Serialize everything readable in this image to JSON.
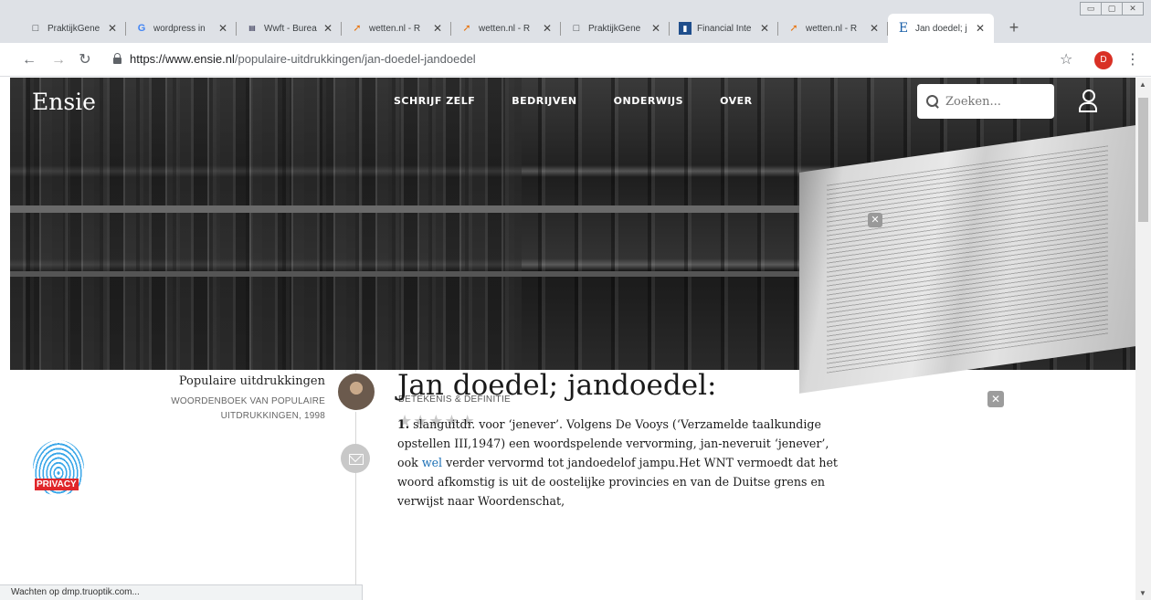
{
  "browser": {
    "tabs": [
      {
        "title": "PraktijkGene",
        "icon": "document-icon"
      },
      {
        "title": "wordpress in",
        "icon": "google-icon"
      },
      {
        "title": "Wwft - Burea",
        "icon": "site-icon"
      },
      {
        "title": "wetten.nl - R",
        "icon": "wetten-icon"
      },
      {
        "title": "wetten.nl - R",
        "icon": "wetten-icon"
      },
      {
        "title": "PraktijkGene",
        "icon": "document-icon"
      },
      {
        "title": "Financial Inte",
        "icon": "bank-icon"
      },
      {
        "title": "wetten.nl - R",
        "icon": "wetten-icon"
      },
      {
        "title": "Jan doedel; j",
        "icon": "ensie-icon",
        "active": true
      }
    ],
    "url_host": "https://www.ensie.nl",
    "url_path": "/populaire-uitdrukkingen/jan-doedel-jandoedel",
    "profile_initial": "D",
    "status_text": "Wachten op dmp.truoptik.com..."
  },
  "site": {
    "logo": "Ensie",
    "nav": [
      "SCHRIJF ZELF",
      "BEDRIJVEN",
      "ONDERWIJS",
      "OVER"
    ],
    "search_placeholder": "Zoeken...",
    "privacy_label": "PRIVACY"
  },
  "sidebar": {
    "dictionary_name": "Populaire uitdrukkingen",
    "dictionary_sub": "WOORDENBOEK VAN POPULAIRE UITDRUKKINGEN, 1998"
  },
  "article": {
    "kicker": "BETEKENIS & DEFINITIE",
    "rating": 0,
    "rating_max": 5,
    "title": "Jan doedel; jandoedel:",
    "body_number": "1.",
    "body_part1": " slanguitdr. voor ‘jenever’. Volgens De Vooys (‘Verzamelde taalkundige opstellen III,1947) een woordspelende vervorming, jan-neveruit ‘jenever’, ook ",
    "body_link": "wel",
    "body_part2": " verder vervormd tot jandoedelof jampu.Het WNT vermoedt dat het woord afkomstig is uit de oostelijke provincies en van de Duitse grens en verwijst naar Woordenschat,"
  },
  "colors": {
    "link": "#1a6fb5",
    "privacy_badge": "#e0262a",
    "profile": "#d93025"
  }
}
